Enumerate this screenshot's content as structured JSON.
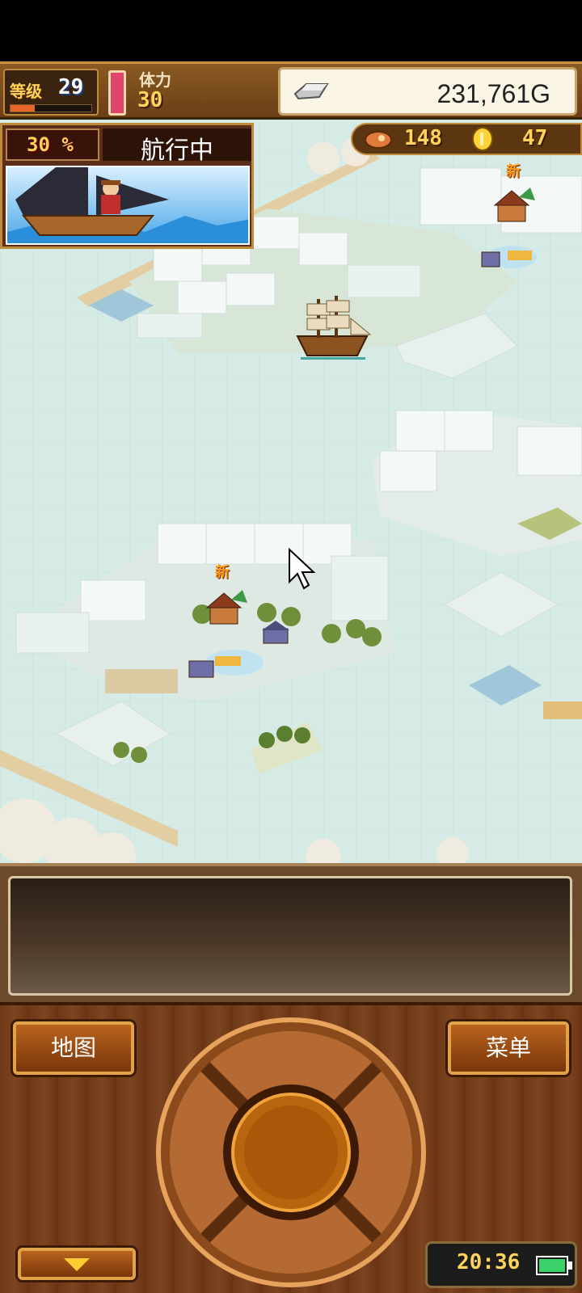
{
  "hud": {
    "level_label": "等级",
    "level": "29",
    "exp_fraction": 0.3,
    "stamina_label": "体力",
    "stamina": "30",
    "gold": "231,761G"
  },
  "resources": {
    "fish": "148",
    "coins": "47"
  },
  "voyage": {
    "percent": "30 %",
    "status": "航行中"
  },
  "map": {
    "new_badge": "新",
    "icons": [
      "ship-icon",
      "town-icon",
      "port-icon",
      "cursor-icon"
    ]
  },
  "message": {
    "text": ""
  },
  "controls": {
    "map_label": "地图",
    "menu_label": "菜单",
    "time": "20:36"
  },
  "colors": {
    "hud_brown": "#6b3f16",
    "gold_text": "#ffd35c",
    "sea": "#d6ebe6",
    "snow": "#f2f7f5",
    "stamina": "#e0466c",
    "battery": "#3bd16a"
  }
}
